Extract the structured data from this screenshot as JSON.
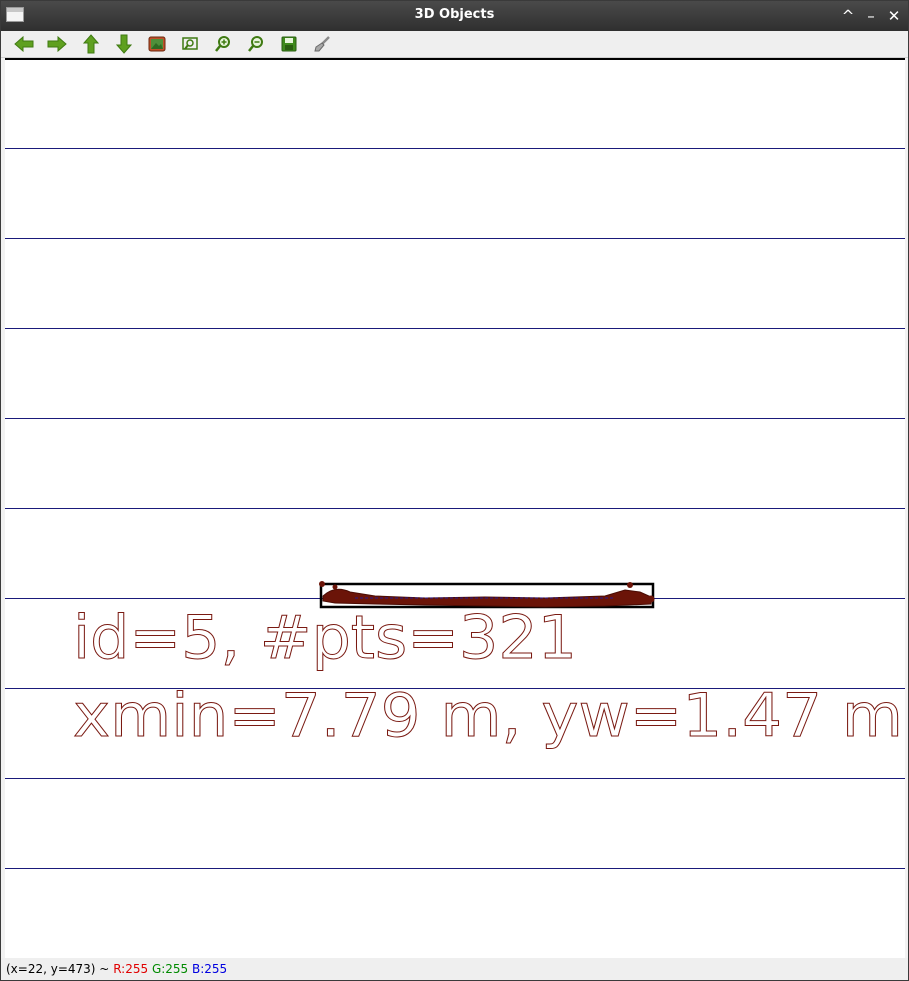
{
  "window": {
    "title": "3D Objects"
  },
  "window_controls": {
    "maximize_glyph": "^",
    "minimize_glyph": "–",
    "close_glyph": "✕"
  },
  "toolbar": {
    "buttons": [
      {
        "name": "pan-left-button",
        "icon": "arrow-left-icon"
      },
      {
        "name": "pan-right-button",
        "icon": "arrow-right-icon"
      },
      {
        "name": "pan-up-button",
        "icon": "arrow-up-icon"
      },
      {
        "name": "pan-down-button",
        "icon": "arrow-down-icon"
      },
      {
        "name": "zoom-reset-button",
        "icon": "image-icon"
      },
      {
        "name": "zoom-region-button",
        "icon": "zoom-region-icon"
      },
      {
        "name": "zoom-in-button",
        "icon": "zoom-in-icon"
      },
      {
        "name": "zoom-out-button",
        "icon": "zoom-out-icon"
      },
      {
        "name": "save-image-button",
        "icon": "floppy-disk-icon"
      },
      {
        "name": "properties-button",
        "icon": "brush-icon"
      }
    ]
  },
  "canvas": {
    "background": "#ffffff",
    "gridline_color": "#1a1a7a",
    "object_color": "#6b1408",
    "bbox_color": "#000000",
    "label_line1": "id=5, #pts=321",
    "label_line2": "xmin=7.79 m, yw=1.47 m"
  },
  "status": {
    "coords": "(x=22, y=473) ~",
    "r_label": "R:255",
    "g_label": "G:255",
    "b_label": "B:255"
  }
}
